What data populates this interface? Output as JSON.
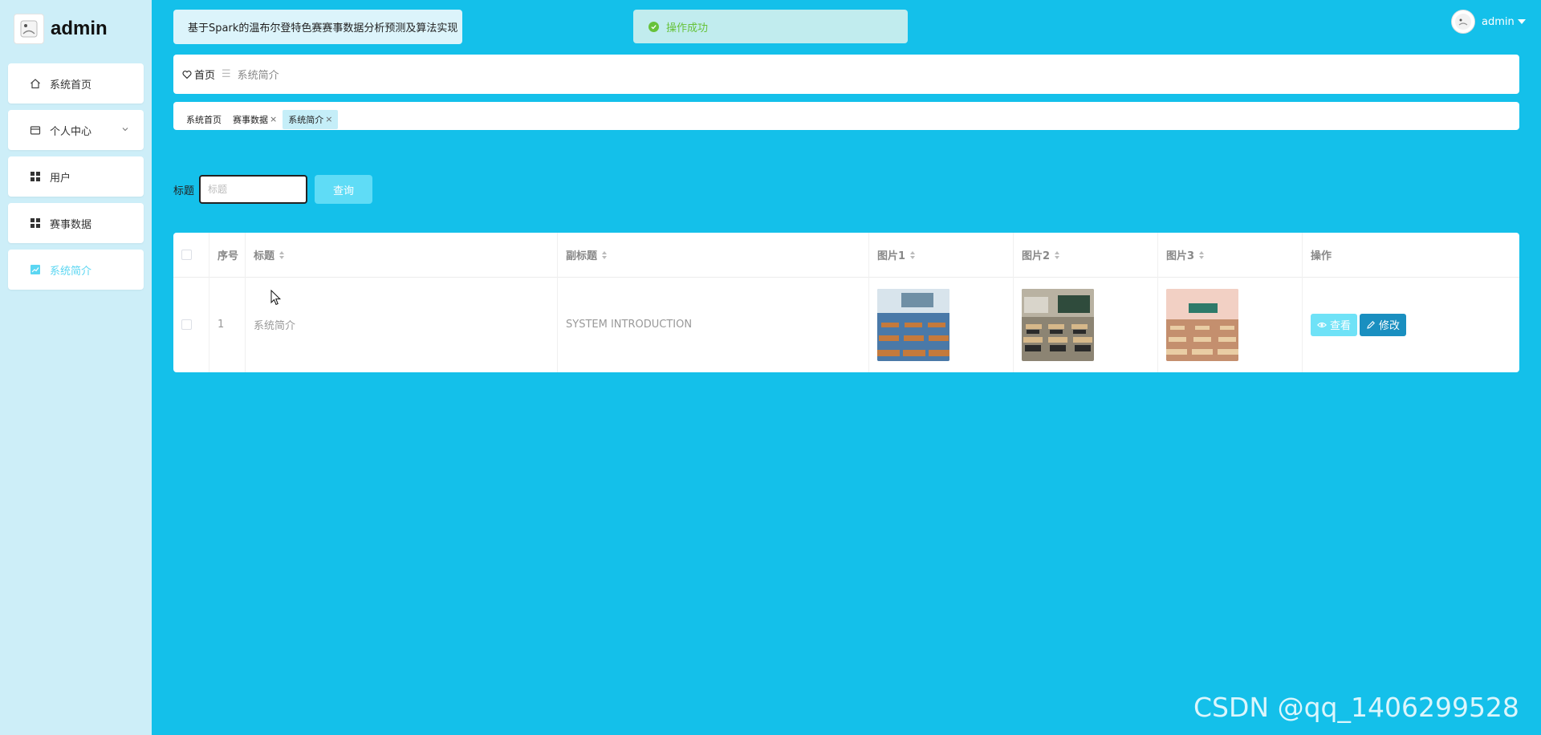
{
  "brand": {
    "title": "admin"
  },
  "sidebar": {
    "items": [
      {
        "label": "系统首页",
        "icon": "home-icon"
      },
      {
        "label": "个人中心",
        "icon": "wallet-icon"
      },
      {
        "label": "用户",
        "icon": "grid-icon"
      },
      {
        "label": "赛事数据",
        "icon": "grid-icon"
      },
      {
        "label": "系统简介",
        "icon": "chart-icon"
      }
    ]
  },
  "header": {
    "system_title": "基于Spark的温布尔登特色赛赛事数据分析预测及算法实现",
    "toast": "操作成功",
    "user_name": "admin"
  },
  "breadcrumb": {
    "home": "首页",
    "separator": "☰",
    "current": "系统简介"
  },
  "tags": [
    {
      "label": "系统首页"
    },
    {
      "label": "赛事数据"
    },
    {
      "label": "系统简介"
    }
  ],
  "search": {
    "label": "标题",
    "placeholder": "标题",
    "button": "查询"
  },
  "table": {
    "headers": {
      "index": "序号",
      "title": "标题",
      "subtitle": "副标题",
      "image1": "图片1",
      "image2": "图片2",
      "image3": "图片3",
      "actions": "操作"
    },
    "rows": [
      {
        "index": "1",
        "title": "系统简介",
        "subtitle": "SYSTEM INTRODUCTION"
      }
    ],
    "view_button": "查看",
    "edit_button": "修改"
  },
  "watermark": "CSDN @qq_1406299528",
  "colors": {
    "page_bg": "#14c0ea",
    "sidebar_bg": "#cdeef8",
    "accent": "#5bd6f2",
    "success": "#67c23a",
    "edit_button": "#1a8fc0"
  }
}
